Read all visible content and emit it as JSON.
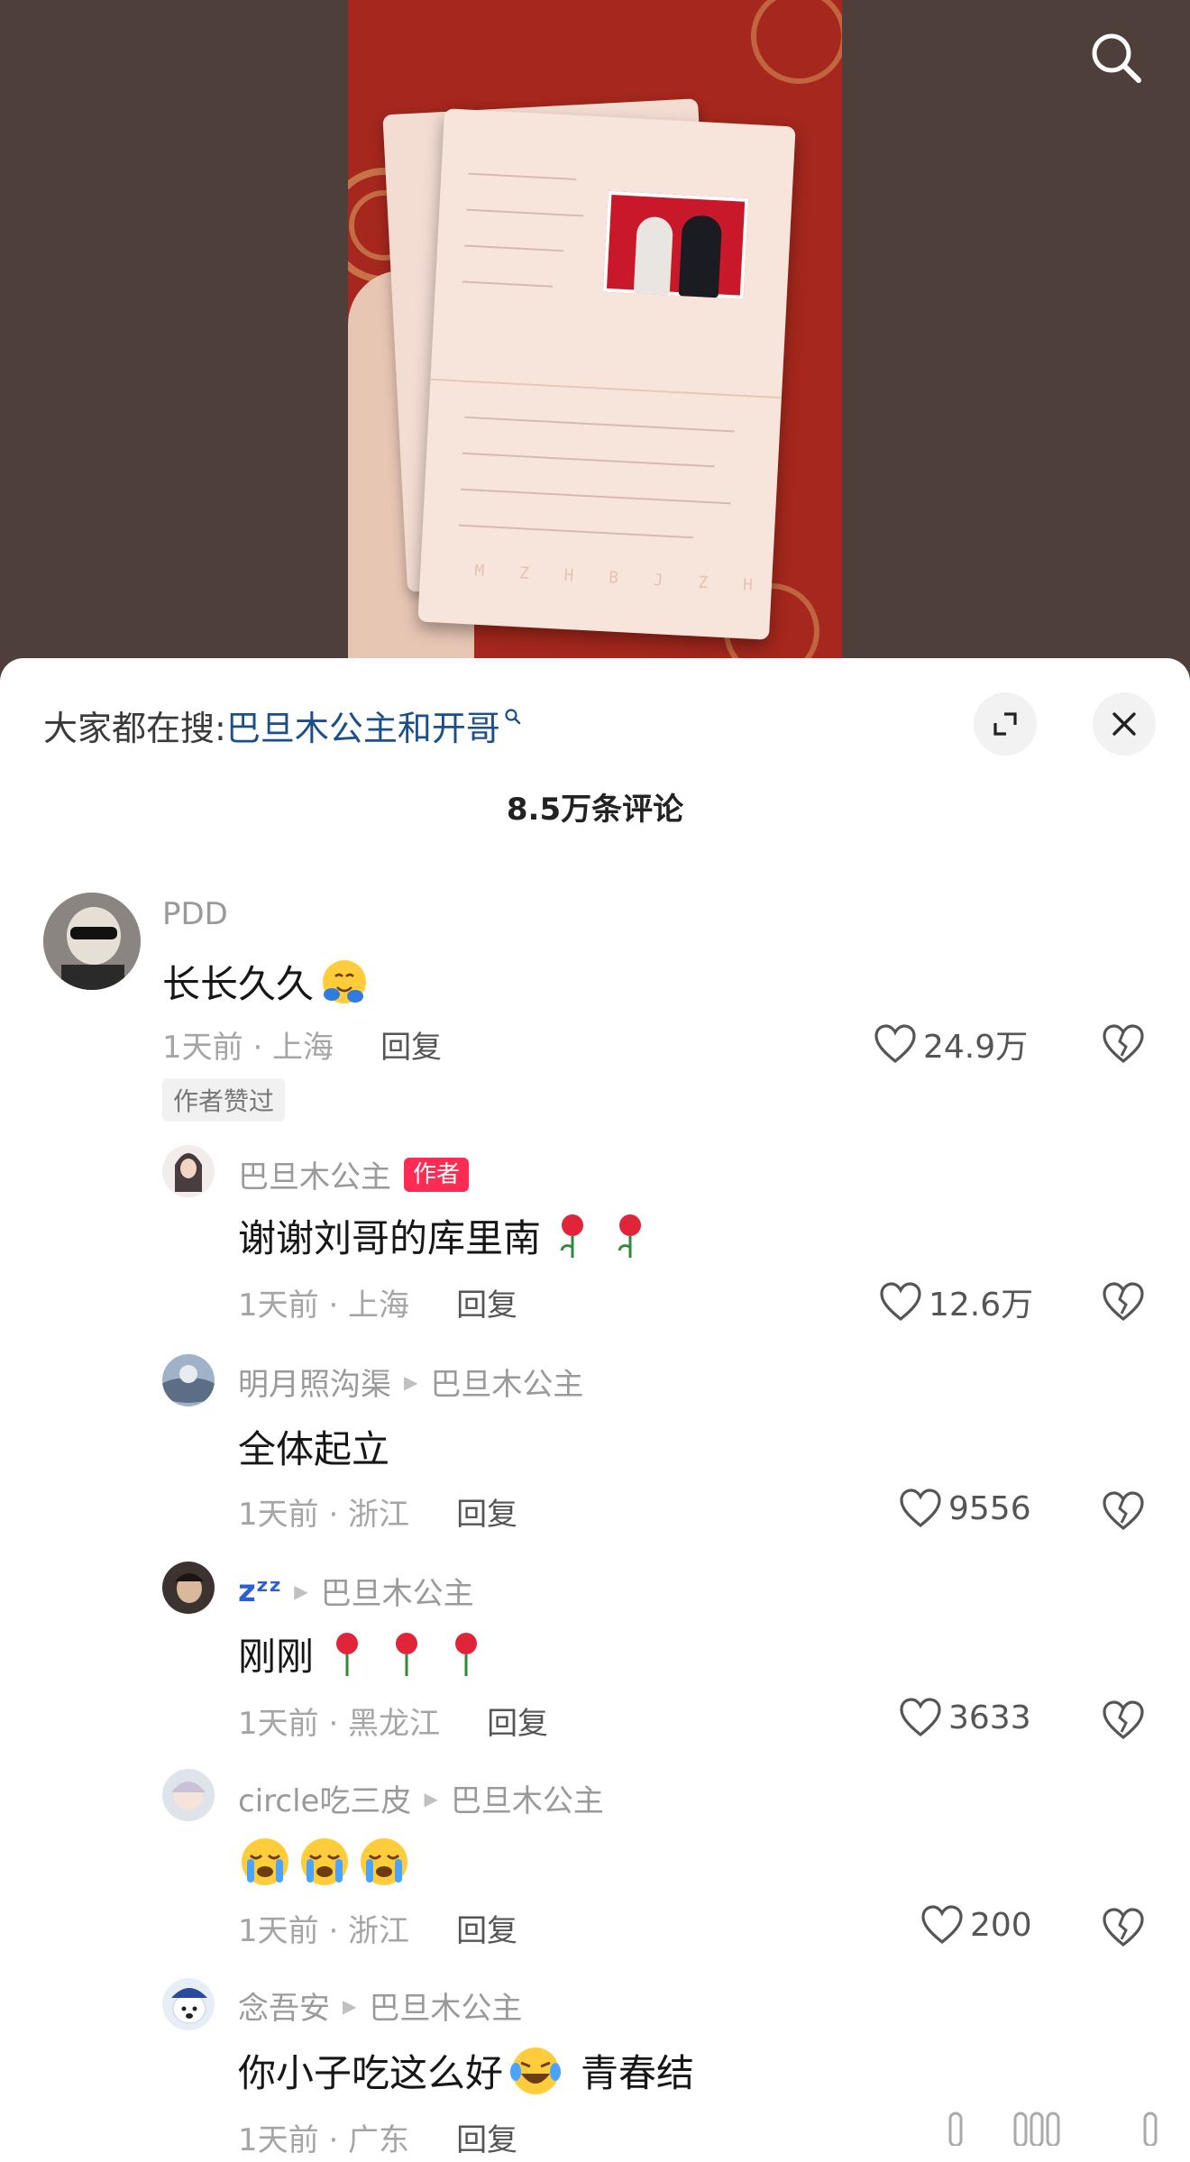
{
  "header": {
    "search_prefix": "大家都在搜:",
    "search_term": "巴旦木公主和开哥",
    "comment_count": "8.5万条评论"
  },
  "icons": {
    "top_search": "search-icon",
    "expand": "expand-icon",
    "close": "close-icon",
    "like": "heart-icon",
    "dislike": "broken-heart-icon"
  },
  "certificate": {
    "code": "M Z H B J Z H"
  },
  "comments": [
    {
      "user": "PDD",
      "text": "长长久久",
      "time_loc": "1天前 · 上海",
      "reply": "回复",
      "likes": "24.9万",
      "tag": "作者赞过"
    },
    {
      "user": "巴旦木公主",
      "badge": "作者",
      "text": "谢谢刘哥的库里南",
      "time_loc": "1天前 · 上海",
      "reply": "回复",
      "likes": "12.6万"
    },
    {
      "user": "明月照沟渠",
      "reply_to": "巴旦木公主",
      "text": "全体起立",
      "time_loc": "1天前 · 浙江",
      "reply": "回复",
      "likes": "9556"
    },
    {
      "user": "zᶻᶻ",
      "reply_to": "巴旦木公主",
      "text": "刚刚",
      "time_loc": "1天前 · 黑龙江",
      "reply": "回复",
      "likes": "3633"
    },
    {
      "user": "circle吃三皮",
      "reply_to": "巴旦木公主",
      "text": "",
      "time_loc": "1天前 · 浙江",
      "reply": "回复",
      "likes": "200"
    },
    {
      "user": "念吾安",
      "reply_to": "巴旦木公主",
      "text_a": "你小子吃这么好",
      "text_b": "青春结",
      "time_loc": "1天前 · 广东",
      "reply": "回复"
    }
  ],
  "colors": {
    "accent_link": "#1a4f8a",
    "author_badge": "#fe2c55",
    "video_bg": "#a5271d"
  }
}
